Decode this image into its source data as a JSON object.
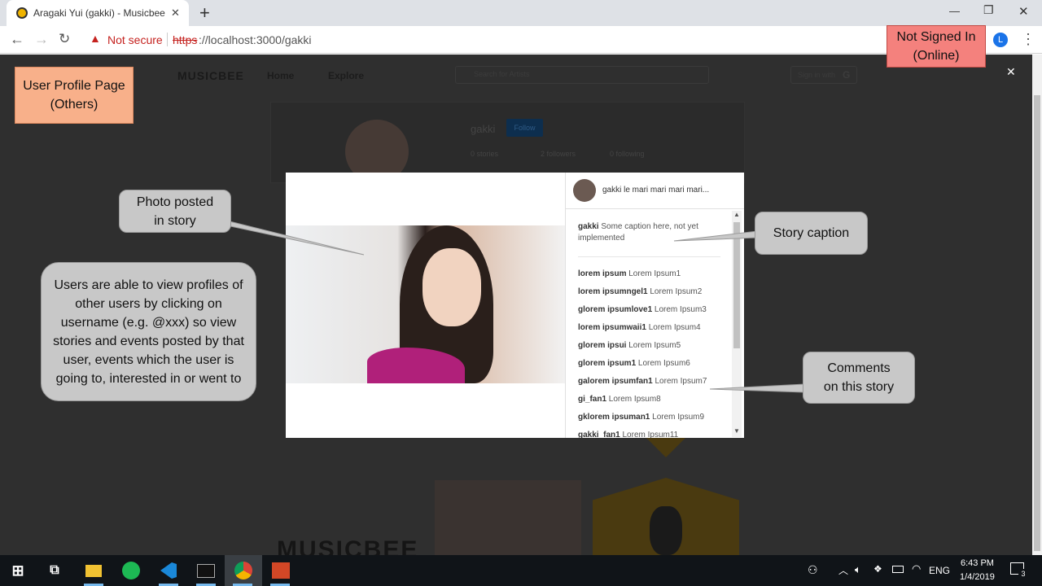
{
  "browser": {
    "tab_title": "Aragaki Yui (gakki) - Musicbee",
    "new_tab": "+",
    "security_label": "Not secure",
    "url_scheme": "https",
    "url_rest": "://localhost:3000/gakki",
    "profile_initial": "L",
    "window_minimize": "—",
    "window_restore": "❐",
    "window_close": "✕",
    "menu": "⋮"
  },
  "site": {
    "logo": "MUSICBEE",
    "nav": [
      "Home",
      "Explore"
    ],
    "search_placeholder": "Search for Artists",
    "sign_in": "Sign in with",
    "sign_in_provider": "G",
    "profile": {
      "username": "gakki",
      "follow": "Follow",
      "stories": "0 stories",
      "followers": "2 followers",
      "following": "0 following"
    },
    "bottom_logo": "MUSICBEE"
  },
  "modal": {
    "close": "✕",
    "header_text": "gakki le mari mari mari mari...",
    "caption_user": "gakki",
    "caption_text": "Some caption here, not yet implemented",
    "comments": [
      {
        "user": "lorem ipsum",
        "text": "Lorem Ipsum1"
      },
      {
        "user": "lorem ipsumngel1",
        "text": "Lorem Ipsum2"
      },
      {
        "user": "glorem ipsumlove1",
        "text": "Lorem Ipsum3"
      },
      {
        "user": "lorem ipsumwaii1",
        "text": "Lorem Ipsum4"
      },
      {
        "user": "glorem ipsui",
        "text": "Lorem Ipsum5"
      },
      {
        "user": "glorem ipsum1",
        "text": "Lorem Ipsum6"
      },
      {
        "user": "galorem ipsumfan1",
        "text": "Lorem Ipsum7"
      },
      {
        "user": "gi_fan1",
        "text": "Lorem Ipsum8"
      },
      {
        "user": "gklorem ipsuman1",
        "text": "Lorem Ipsum9"
      },
      {
        "user": "gakki_fan1",
        "text": "Lorem Ipsum11"
      }
    ]
  },
  "annotations": {
    "page_type": "User Profile Page (Others)",
    "signin_state": "Not Signed In (Online)",
    "photo": "Photo posted in story",
    "description": "Users are able to view profiles of other users by clicking on username (e.g. @xxx) so view stories and events posted by that user, events which the user is going to, interested in or went to",
    "caption": "Story caption",
    "comments": "Comments on this story"
  },
  "taskbar": {
    "time": "6:43 PM",
    "date": "1/4/2019",
    "lang": "ENG",
    "notifications": "3"
  },
  "colors": {
    "accent": "#1a73e8",
    "warning": "#c5221f",
    "callout_orange": "#f8b08a",
    "callout_red": "#f4817d",
    "follow": "#1565c0"
  }
}
